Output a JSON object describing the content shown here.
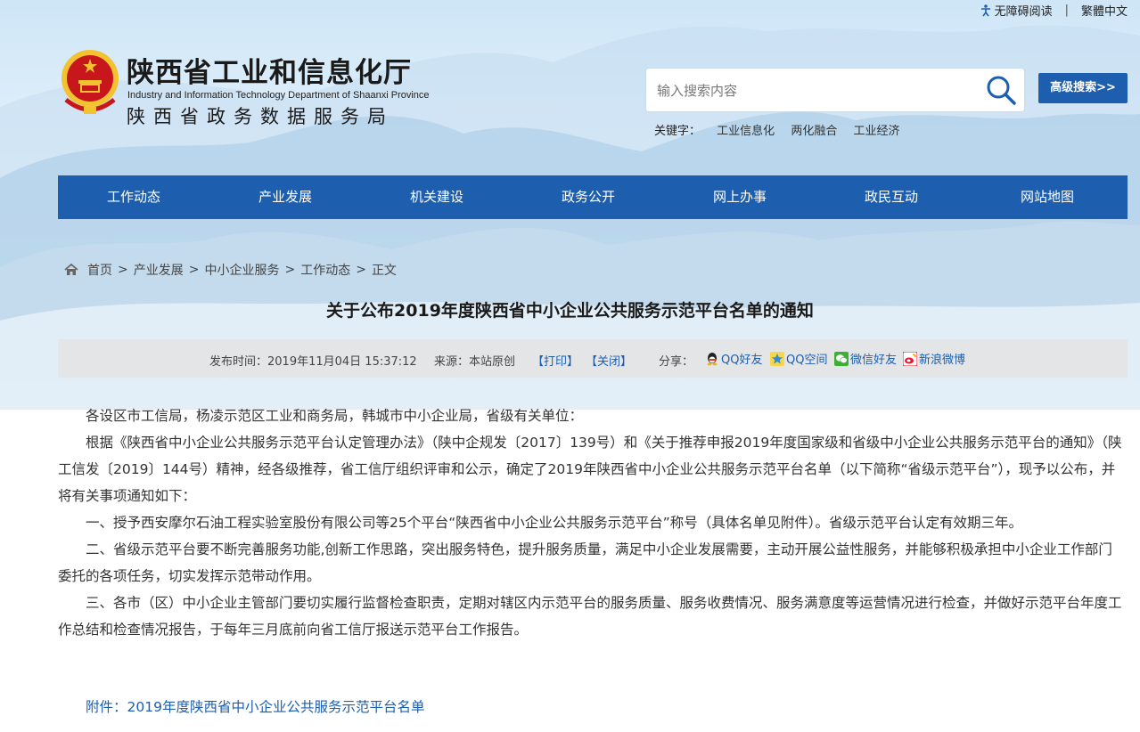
{
  "topbar": {
    "accessibility": "无障碍阅读",
    "separator": "|",
    "traditional": "繁體中文"
  },
  "header": {
    "title_cn": "陕西省工业和信息化厅",
    "title_en": "Industry and Information Technology Department of Shaanxi Province",
    "subtitle": "陕西省政务数据服务局"
  },
  "search": {
    "placeholder": "输入搜索内容",
    "advanced_label": "高级搜索>>",
    "keywords_label": "关键字：",
    "keywords": [
      "工业信息化",
      "两化融合",
      "工业经济"
    ]
  },
  "nav": {
    "items": [
      "工作动态",
      "产业发展",
      "机关建设",
      "政务公开",
      "网上办事",
      "政民互动",
      "网站地图"
    ]
  },
  "breadcrumb": {
    "items": [
      "首页",
      "产业发展",
      "中小企业服务",
      "工作动态",
      "正文"
    ],
    "separator": ">"
  },
  "article": {
    "title": "关于公布2019年度陕西省中小企业公共服务示范平台名单的通知",
    "meta": {
      "time": "发布时间：2019年11月04日 15:37:12",
      "source": "来源：本站原创",
      "print": "【打印】",
      "close": "【关闭】",
      "share_label": "分享：",
      "share": [
        "QQ好友",
        "QQ空间",
        "微信好友",
        "新浪微博"
      ]
    },
    "paragraphs": [
      "各设区市工信局，杨凌示范区工业和商务局，韩城市中小企业局，省级有关单位：",
      "根据《陕西省中小企业公共服务示范平台认定管理办法》（陕中企规发〔2017〕139号）和《关于推荐申报2019年度国家级和省级中小企业公共服务示范平台的通知》（陕工信发〔2019〕144号）精神，经各级推荐，省工信厅组织评审和公示，确定了2019年陕西省中小企业公共服务示范平台名单（以下简称“省级示范平台”），现予以公布，并将有关事项通知如下：",
      "一、授予西安摩尔石油工程实验室股份有限公司等25个平台“陕西省中小企业公共服务示范平台”称号（具体名单见附件）。省级示范平台认定有效期三年。",
      "二、省级示范平台要不断完善服务功能,创新工作思路，突出服务特色，提升服务质量，满足中小企业发展需要，主动开展公益性服务，并能够积极承担中小企业工作部门委托的各项任务，切实发挥示范带动作用。",
      "三、各市（区）中小企业主管部门要切实履行监督检查职责，定期对辖区内示范平台的服务质量、服务收费情况、服务满意度等运营情况进行检查，并做好示范平台年度工作总结和检查情况报告，于每年三月底前向省工信厅报送示范平台工作报告。"
    ],
    "attachment": "附件：2019年度陕西省中小企业公共服务示范平台名单"
  },
  "colors": {
    "brand_blue": "#1d5fae",
    "meta_bg": "#e4e5e7",
    "emblem_red": "#c8161d",
    "emblem_gold": "#f2c230"
  }
}
